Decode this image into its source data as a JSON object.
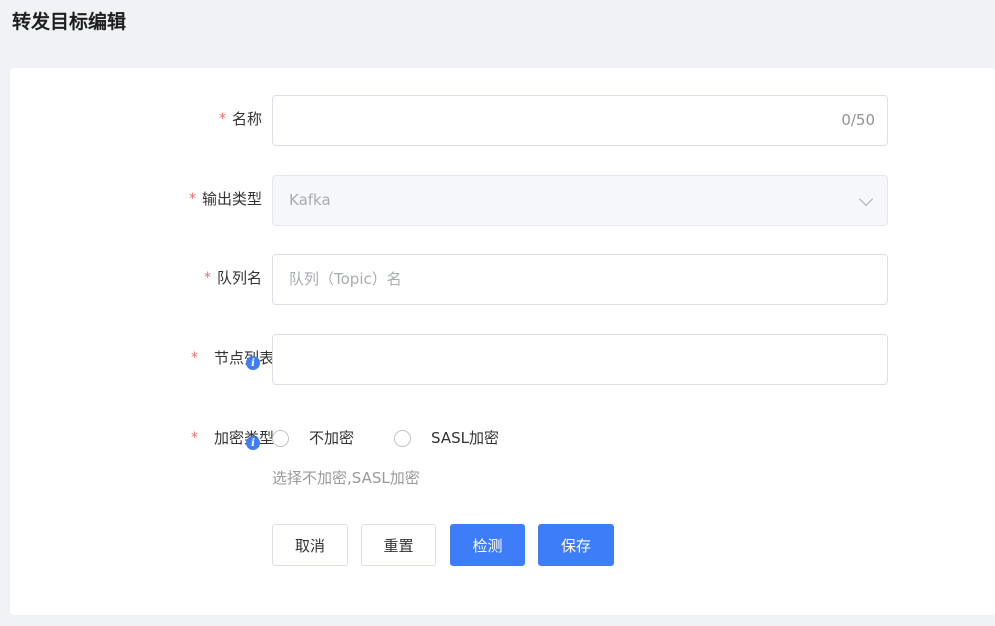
{
  "page": {
    "title": "转发目标编辑"
  },
  "form": {
    "name": {
      "label": "名称",
      "required_mark": "*",
      "value": "",
      "counter": "0/50"
    },
    "output_type": {
      "label": "输出类型",
      "required_mark": "*",
      "selected": "Kafka"
    },
    "queue_name": {
      "label": "队列名",
      "required_mark": "*",
      "placeholder": "队列（Topic）名"
    },
    "node_list": {
      "label": "节点列表",
      "required_mark": "*",
      "value": ""
    },
    "encryption_type": {
      "label": "加密类型",
      "required_mark": "*",
      "options": [
        "不加密",
        "SASL加密"
      ],
      "hint": "选择不加密,SASL加密"
    }
  },
  "actions": {
    "cancel": "取消",
    "reset": "重置",
    "test": "检测",
    "save": "保存"
  },
  "colors": {
    "primary": "#3d7ef8",
    "required": "#f56c6c",
    "info": "#3f7cf5"
  },
  "icons": {
    "info": "info-icon",
    "dropdown": "chevron-down-icon"
  }
}
